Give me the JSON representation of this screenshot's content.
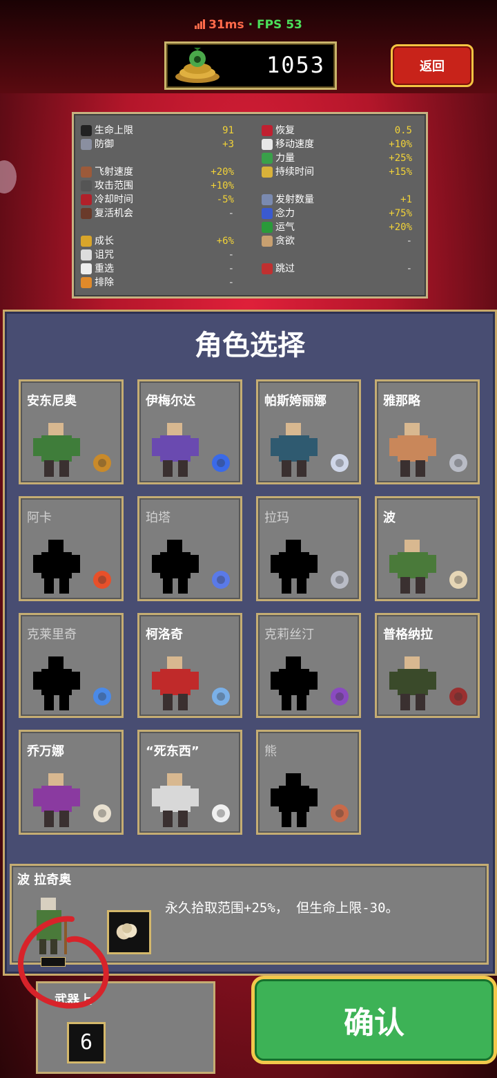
{
  "status": {
    "ping": "31ms",
    "separator": "·",
    "fps": "FPS 53"
  },
  "gold": {
    "amount": "1053"
  },
  "back_label": "返回",
  "stats": {
    "left": [
      {
        "label": "生命上限",
        "value": "91",
        "icon": "heart-icon",
        "color": "#222"
      },
      {
        "label": "防御",
        "value": "+3",
        "icon": "armor-icon",
        "color": "#8a8fa0"
      },
      {
        "label": "飞射速度",
        "value": "+20%",
        "icon": "speed-icon",
        "color": "#9c5a3a"
      },
      {
        "label": "攻击范围",
        "value": "+10%",
        "icon": "area-icon",
        "color": "#555"
      },
      {
        "label": "冷却时间",
        "value": "-5%",
        "icon": "clock-icon",
        "color": "#b0202a"
      },
      {
        "label": "复活机会",
        "value": "-",
        "icon": "revive-icon",
        "color": "#6a3a2a"
      },
      {
        "label": "成长",
        "value": "+6%",
        "icon": "crown-icon",
        "color": "#d9a52a"
      },
      {
        "label": "诅咒",
        "value": "-",
        "icon": "skull-icon",
        "color": "#ddd"
      },
      {
        "label": "重选",
        "value": "-",
        "icon": "dice-icon",
        "color": "#eee"
      },
      {
        "label": "排除",
        "value": "-",
        "icon": "banish-icon",
        "color": "#e08a2a"
      }
    ],
    "right": [
      {
        "label": "恢复",
        "value": "0.5",
        "icon": "regen-heart-icon",
        "color": "#c02030"
      },
      {
        "label": "移动速度",
        "value": "+10%",
        "icon": "wing-icon",
        "color": "#e8e8e8"
      },
      {
        "label": "力量",
        "value": "+25%",
        "icon": "might-icon",
        "color": "#3aa04a"
      },
      {
        "label": "持续时间",
        "value": "+15%",
        "icon": "hourglass-icon",
        "color": "#d9b23a"
      },
      {
        "label": "发射数量",
        "value": "+1",
        "icon": "amount-icon",
        "color": "#7a8ab0"
      },
      {
        "label": "念力",
        "value": "+75%",
        "icon": "magnet-icon",
        "color": "#3a5ad0"
      },
      {
        "label": "运气",
        "value": "+20%",
        "icon": "clover-icon",
        "color": "#2a9a3a"
      },
      {
        "label": "贪欲",
        "value": "-",
        "icon": "greed-icon",
        "color": "#c8a070"
      },
      {
        "label": "跳过",
        "value": "-",
        "icon": "skip-icon",
        "color": "#c03030"
      }
    ]
  },
  "panel_title": "角色选择",
  "characters": [
    {
      "name": "安东尼奥",
      "locked": false,
      "weapon": "whip-icon",
      "fig": "#3f7d3a",
      "wc": "#c98a2a"
    },
    {
      "name": "伊梅尔达",
      "locked": false,
      "weapon": "wand-icon",
      "fig": "#6a4ab0",
      "wc": "#3a6ae8"
    },
    {
      "name": "帕斯姱丽娜",
      "locked": false,
      "weapon": "runetracer-icon",
      "fig": "#2f5a70",
      "wc": "#cfd6e8"
    },
    {
      "name": "雅那略",
      "locked": false,
      "weapon": "knife-icon",
      "fig": "#c9875a",
      "wc": "#b9bcc6"
    },
    {
      "name": "阿卡",
      "locked": true,
      "weapon": "fire-wand-icon",
      "fig": "#000",
      "wc": "#e8502a"
    },
    {
      "name": "珀塔",
      "locked": true,
      "weapon": "lightning-ring-icon",
      "fig": "#000",
      "wc": "#5a7ae8"
    },
    {
      "name": "拉玛",
      "locked": true,
      "weapon": "axe-icon",
      "fig": "#000",
      "wc": "#b9bcc6"
    },
    {
      "name": "波",
      "locked": false,
      "weapon": "garlic-icon",
      "fig": "#4a7a3a",
      "wc": "#e6d6b6"
    },
    {
      "name": "克莱里奇",
      "locked": true,
      "weapon": "holy-water-icon",
      "fig": "#000",
      "wc": "#4a8ae8"
    },
    {
      "name": "柯洛奇",
      "locked": false,
      "weapon": "cross-icon",
      "fig": "#c02a2a",
      "wc": "#7ab0e8"
    },
    {
      "name": "克莉丝汀",
      "locked true": true,
      "locked": true,
      "weapon": "pentagram-icon",
      "fig": "#000",
      "wc": "#8a4ac0"
    },
    {
      "name": "普格纳拉",
      "locked": false,
      "weapon": "pistol-icon",
      "fig": "#3a4a2a",
      "wc": "#9a3030"
    },
    {
      "name": "乔万娜",
      "locked": false,
      "weapon": "peachone-icon",
      "fig": "#8a3aa0",
      "wc": "#e8e0d0"
    },
    {
      "name": "“死东西”",
      "locked": false,
      "weapon": "bone-icon",
      "fig": "#d8d8d8",
      "wc": "#f0f0f0"
    },
    {
      "name": "熊",
      "locked": true,
      "weapon": "cherry-bomb-icon",
      "fig": "#000",
      "wc": "#c86a4a"
    }
  ],
  "selected": {
    "name": "波  拉奇奥",
    "description": "永久拾取范围+25%， 但生命上限-30。",
    "weapon": "garlic-icon"
  },
  "weapon_cap": {
    "label": "武器上",
    "value": "6"
  },
  "confirm_label": "确认"
}
